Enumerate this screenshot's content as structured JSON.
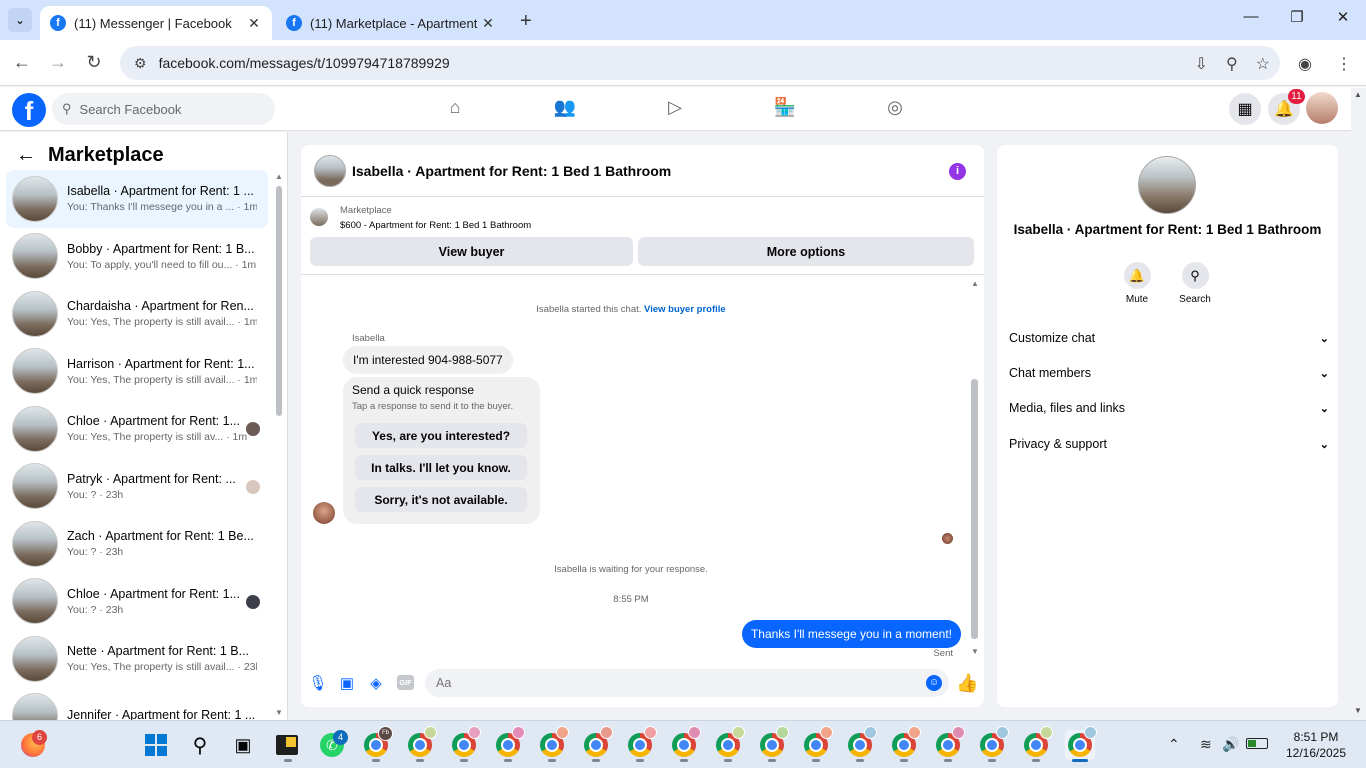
{
  "browser": {
    "tabs": [
      {
        "title": "(11) Messenger | Facebook",
        "active": true
      },
      {
        "title": "(11) Marketplace - Apartment f",
        "active": false
      }
    ],
    "url": "facebook.com/messages/t/1099794718789929"
  },
  "fb": {
    "search_placeholder": "Search Facebook",
    "notification_count": "11"
  },
  "sidebar": {
    "title": "Marketplace",
    "conversations": [
      {
        "name": "Isabella · Apartment for Rent: 1 ...",
        "preview": "You: Thanks I'll messege you in a ... · 1m",
        "active": true
      },
      {
        "name": "Bobby · Apartment for Rent: 1 B...",
        "preview": "You: To apply, you'll need to fill ou... · 1m",
        "active": false
      },
      {
        "name": "Chardaisha · Apartment for Ren...",
        "preview": "You: Yes, The property is still avail... · 1m",
        "active": false
      },
      {
        "name": "Harrison · Apartment for Rent: 1...",
        "preview": "You: Yes, The property is still avail... · 1m",
        "active": false
      },
      {
        "name": "Chloe · Apartment for Rent: 1...",
        "preview": "You: Yes, The property is still av... · 1m",
        "active": false,
        "seen": true
      },
      {
        "name": "Patryk · Apartment for Rent: ...",
        "preview": "You: ? · 23h",
        "active": false,
        "seen": true
      },
      {
        "name": "Zach · Apartment for Rent: 1 Be...",
        "preview": "You: ? · 23h",
        "active": false
      },
      {
        "name": "Chloe · Apartment for Rent: 1...",
        "preview": "You: ? · 23h",
        "active": false,
        "seen": true
      },
      {
        "name": "Nette · Apartment for Rent: 1 B...",
        "preview": "You: Yes, The property is still avail... · 23h",
        "active": false
      },
      {
        "name": "Jennifer · Apartment for Rent: 1 ...",
        "preview": "",
        "active": false
      }
    ]
  },
  "chat": {
    "title": "Isabella · Apartment for Rent: 1 Bed 1 Bathroom",
    "marketplace_label": "Marketplace",
    "listing": "$600 - Apartment for Rent: 1 Bed 1 Bathroom",
    "view_buyer": "View buyer",
    "more_options": "More options",
    "started_text": "Isabella started this chat.",
    "view_buyer_profile": "View buyer profile",
    "sender_name": "Isabella",
    "incoming_message": "I'm interested 904-988-5077",
    "quick_title": "Send a quick response",
    "quick_sub": "Tap a response to send it to the buyer.",
    "quick_responses": [
      "Yes, are you interested?",
      "In talks. I'll let you know.",
      "Sorry, it's not available."
    ],
    "waiting_text": "Isabella is waiting for your response.",
    "timestamp": "8:55 PM",
    "outgoing_message": "Thanks I'll messege you in a moment!",
    "sent_label": "Sent",
    "composer_placeholder": "Aa",
    "gif_label": "GIF"
  },
  "details": {
    "name": "Isabella · Apartment for Rent: 1 Bed 1 Bathroom",
    "mute_label": "Mute",
    "search_label": "Search",
    "sections": [
      "Customize chat",
      "Chat members",
      "Media, files and links",
      "Privacy & support"
    ]
  },
  "taskbar": {
    "firefox_badge": "6",
    "whatsapp_badge": "4",
    "fb_profile_label": "Fb",
    "time": "8:51 PM",
    "date": "12/16/2025"
  }
}
